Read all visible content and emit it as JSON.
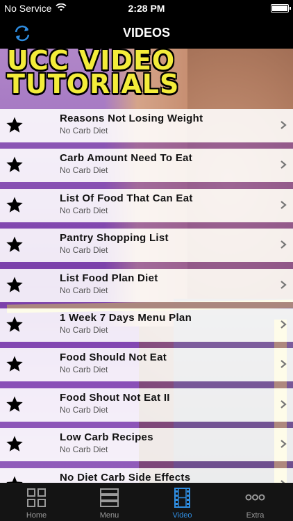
{
  "status_bar": {
    "carrier": "No Service",
    "time": "2:28 PM"
  },
  "nav": {
    "title": "VIDEOS",
    "refresh_icon": "refresh-icon"
  },
  "banner": {
    "line1": "UCC VIDEO",
    "line2": "TUTORIALS"
  },
  "list": {
    "items": [
      {
        "title": "Reasons Not Losing Weight",
        "subtitle": "No Carb Diet"
      },
      {
        "title": "Carb Amount Need To Eat",
        "subtitle": "No Carb Diet"
      },
      {
        "title": "List Of Food That Can Eat",
        "subtitle": "No Carb Diet"
      },
      {
        "title": "Pantry Shopping List",
        "subtitle": "No Carb Diet"
      },
      {
        "title": "List Food Plan Diet",
        "subtitle": "No Carb Diet"
      },
      {
        "title": "1 Week 7 Days Menu Plan",
        "subtitle": "No Carb Diet"
      },
      {
        "title": "Food Should Not Eat",
        "subtitle": "No Carb Diet"
      },
      {
        "title": "Food Shout Not Eat II",
        "subtitle": "No Carb Diet"
      },
      {
        "title": "Low Carb Recipes",
        "subtitle": "No Carb Diet"
      },
      {
        "title": "No Diet Carb Side Effects",
        "subtitle": ""
      }
    ]
  },
  "tab_bar": {
    "tabs": [
      {
        "label": "Home",
        "icon": "grid-icon"
      },
      {
        "label": "Menu",
        "icon": "menu-icon"
      },
      {
        "label": "Video",
        "icon": "film-icon"
      },
      {
        "label": "Extra",
        "icon": "more-icon"
      }
    ],
    "active_color": "#2f8de0",
    "inactive_color": "#9a9a9a"
  }
}
